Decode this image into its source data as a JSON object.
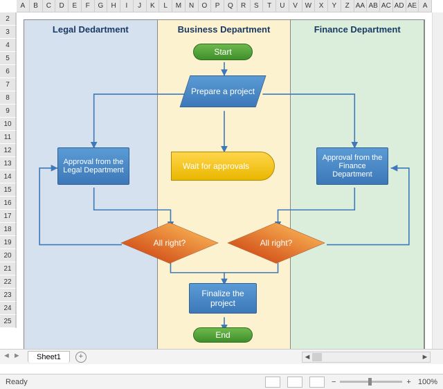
{
  "columns": [
    "A",
    "B",
    "C",
    "D",
    "E",
    "F",
    "G",
    "H",
    "I",
    "J",
    "K",
    "L",
    "M",
    "N",
    "O",
    "P",
    "Q",
    "R",
    "S",
    "T",
    "U",
    "V",
    "W",
    "X",
    "Y",
    "Z",
    "AA",
    "AB",
    "AC",
    "AD",
    "AE",
    "A"
  ],
  "rows": [
    "2",
    "3",
    "4",
    "5",
    "6",
    "7",
    "8",
    "9",
    "10",
    "11",
    "12",
    "13",
    "14",
    "15",
    "16",
    "17",
    "18",
    "19",
    "20",
    "21",
    "22",
    "23",
    "24",
    "25"
  ],
  "lanes": {
    "legal": {
      "title": "Legal Dedartment"
    },
    "business": {
      "title": "Business Department"
    },
    "finance": {
      "title": "Finance Department"
    }
  },
  "shapes": {
    "start": "Start",
    "prepare": "Prepare a project",
    "approval_legal": "Approval from the Legal Department",
    "wait": "Wait for approvals",
    "approval_finance": "Approval from the Finance Department",
    "decision_left": "All right?",
    "decision_right": "All right?",
    "finalize": "Finalize the project",
    "end": "End"
  },
  "tabs": {
    "sheet1": "Sheet1"
  },
  "status": {
    "ready": "Ready",
    "zoom": "100%"
  }
}
